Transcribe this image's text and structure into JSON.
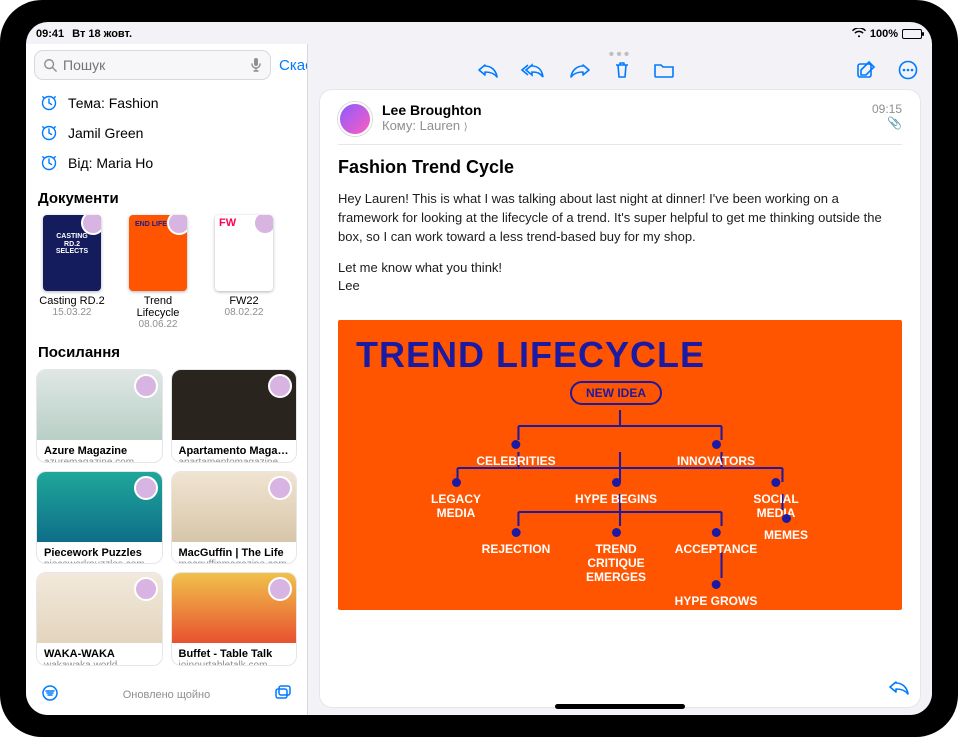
{
  "status": {
    "time": "09:41",
    "date": "Вт 18 жовт.",
    "battery": "100%"
  },
  "sidebar": {
    "search_placeholder": "Пошук",
    "cancel": "Скасувати",
    "suggestions": [
      {
        "label": "Тема: Fashion"
      },
      {
        "label": "Jamil Green"
      },
      {
        "label": "Від: Maria Ho"
      }
    ],
    "section_docs": "Документи",
    "docs": [
      {
        "title": "Casting RD.2",
        "date": "15.03.22"
      },
      {
        "title": "Trend Lifecycle",
        "date": "08.06.22"
      },
      {
        "title": "FW22",
        "date": "08.02.22"
      }
    ],
    "section_links": "Посилання",
    "links": [
      {
        "title": "Azure Magazine",
        "host": "azuremagazine.com"
      },
      {
        "title": "Apartamento Maga…",
        "host": "apartamentomagazine.c…"
      },
      {
        "title": "Piecework Puzzles",
        "host": "pieceworkpuzzles.com"
      },
      {
        "title": "MacGuffin | The Life",
        "host": "macguffinmagazine.com"
      },
      {
        "title": "WAKA-WAKA",
        "host": "wakawaka.world"
      },
      {
        "title": "Buffet - Table Talk",
        "host": "joinourtabletalk.com"
      }
    ],
    "footer_status": "Оновлено щойно"
  },
  "mail": {
    "sender": "Lee Broughton",
    "to_prefix": "Кому:",
    "to_name": "Lauren",
    "time": "09:15",
    "subject": "Fashion Trend Cycle",
    "para1": "Hey Lauren! This is what I was talking about last night at dinner! I've been working on a framework for looking at the lifecycle of a trend. It's super helpful to get me thinking outside the box, so I can work toward a less trend-based buy for my shop.",
    "para2": "Let me know what you think!",
    "sig": "Lee",
    "poster_title": "TREND LIFECYCLE",
    "nodes": {
      "new_idea": "NEW IDEA",
      "celebrities": "CELEBRITIES",
      "innovators": "INNOVATORS",
      "legacy": "LEGACY\nMEDIA",
      "hype_begins": "HYPE BEGINS",
      "social": "SOCIAL\nMEDIA",
      "memes": "MEMES",
      "rejection": "REJECTION",
      "critique": "TREND\nCRITIQUE\nEMERGES",
      "acceptance": "ACCEPTANCE",
      "hype_grows": "HYPE GROWS"
    }
  }
}
